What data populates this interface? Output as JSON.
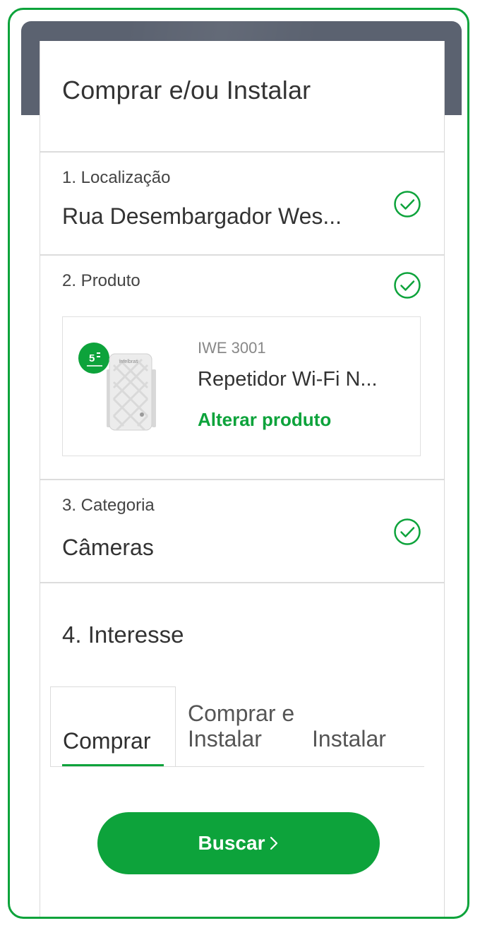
{
  "title": "Comprar e/ou Instalar",
  "steps": {
    "location": {
      "label": "1. Localização",
      "value": "Rua Desembargador Wes..."
    },
    "product": {
      "label": "2. Produto",
      "code": "IWE 3001",
      "name": "Repetidor Wi-Fi N...",
      "change_link": "Alterar produto",
      "brand": "intelbras",
      "warranty_badge": "5"
    },
    "category": {
      "label": "3. Categoria",
      "value": "Câmeras"
    },
    "interest": {
      "label": "4. Interesse",
      "tabs": [
        "Comprar",
        "Comprar e Instalar",
        "Instalar"
      ],
      "active_tab": "Comprar"
    }
  },
  "search_button": "Buscar",
  "colors": {
    "accent": "#0da33b",
    "banner": "#5b6270",
    "text": "#333333"
  }
}
